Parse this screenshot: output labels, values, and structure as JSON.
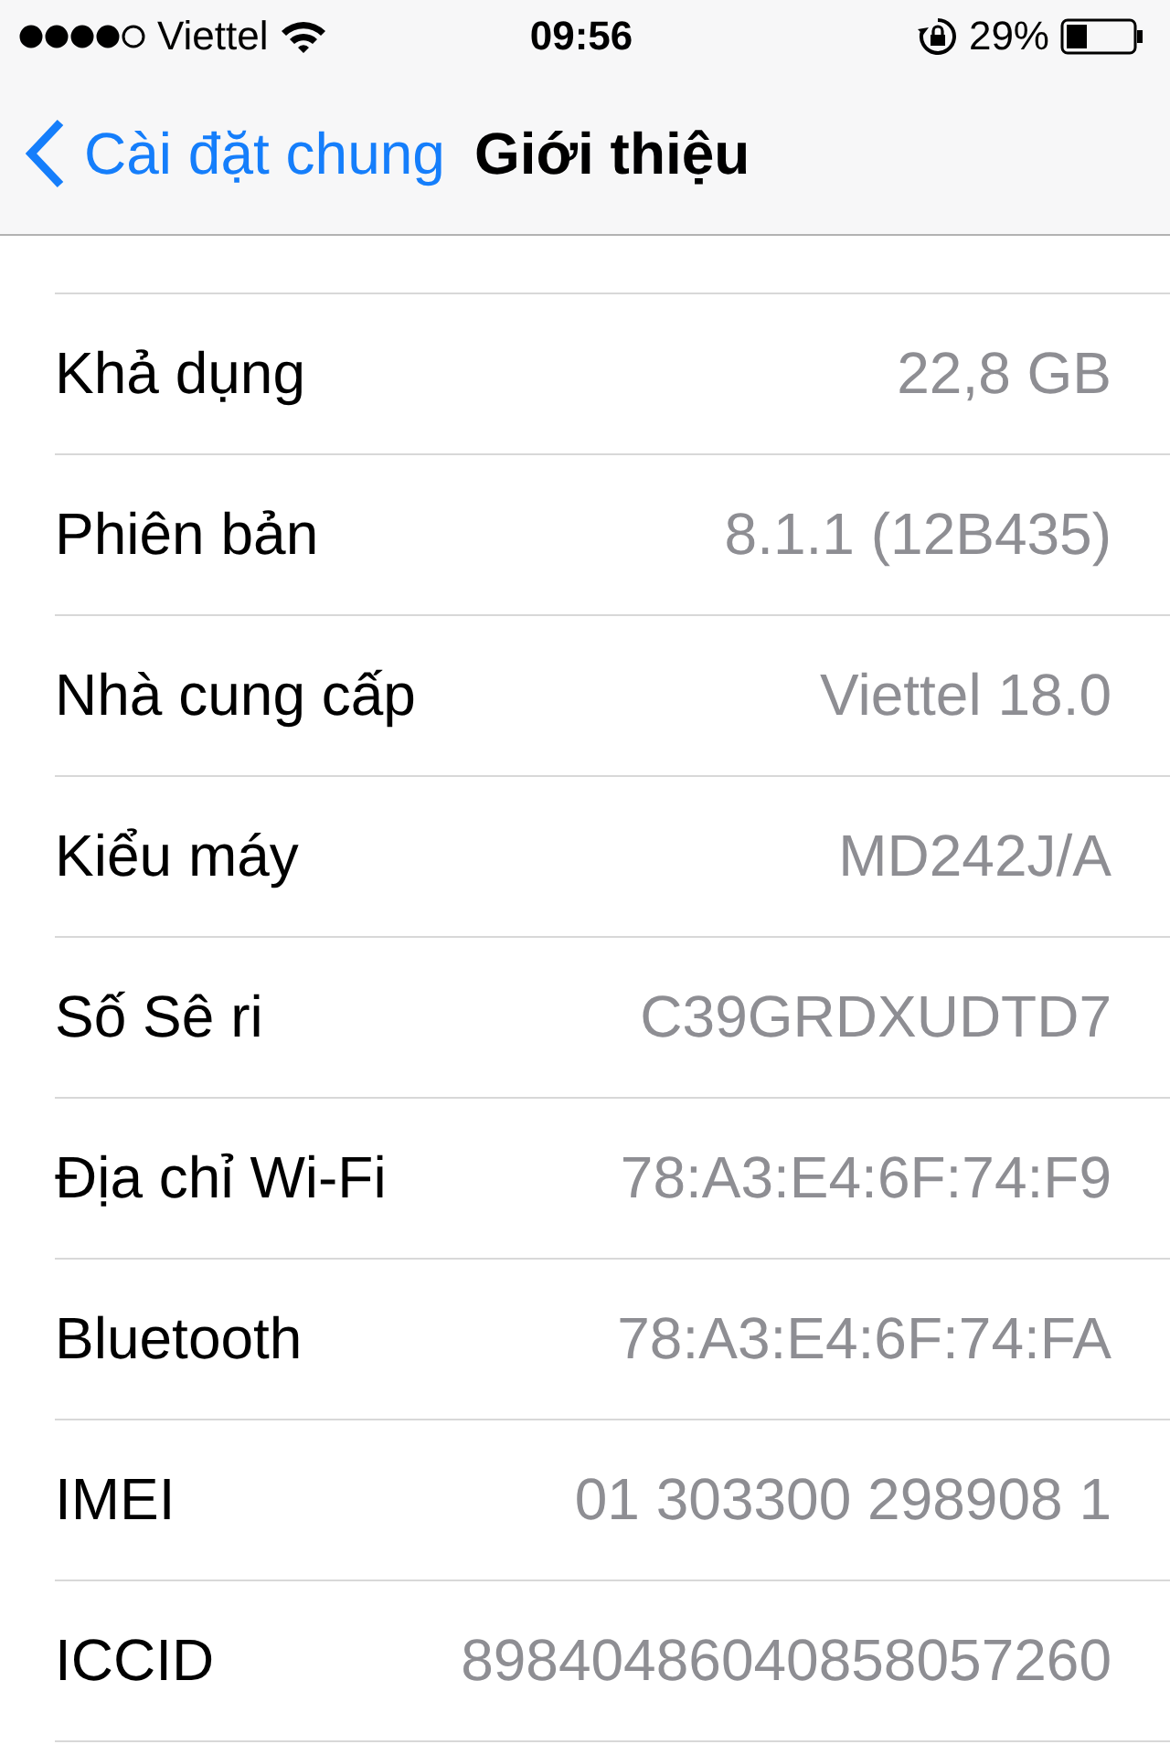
{
  "status_bar": {
    "carrier": "Viettel",
    "time": "09:56",
    "battery": "29%"
  },
  "nav": {
    "back": "Cài đặt chung",
    "title": "Giới thiệu"
  },
  "rows": [
    {
      "label": "Khả dụng",
      "value": "22,8 GB"
    },
    {
      "label": "Phiên bản",
      "value": "8.1.1 (12B435)"
    },
    {
      "label": "Nhà cung cấp",
      "value": "Viettel 18.0"
    },
    {
      "label": "Kiểu máy",
      "value": "MD242J/A"
    },
    {
      "label": "Số Sê ri",
      "value": "C39GRDXUDTD7"
    },
    {
      "label": "Địa chỉ Wi-Fi",
      "value": "78:A3:E4:6F:74:F9"
    },
    {
      "label": "Bluetooth",
      "value": "78:A3:E4:6F:74:FA"
    },
    {
      "label": "IMEI",
      "value": "01 303300 298908 1"
    },
    {
      "label": "ICCID",
      "value": "89840486040858057260"
    }
  ]
}
